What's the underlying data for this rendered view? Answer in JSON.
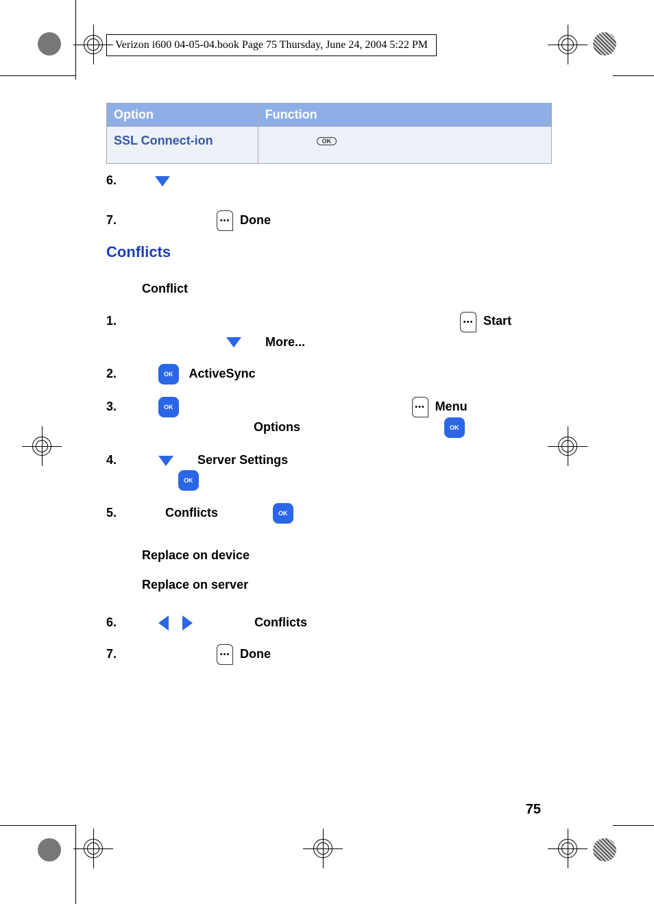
{
  "header_text": "Verizon i600 04-05-04.book  Page 75  Thursday, June 24, 2004  5:22 PM",
  "table": {
    "col1": "Option",
    "col2": "Function",
    "row1_col1": "SSL Connect-ion",
    "ok_outline": "OK"
  },
  "steps_a": {
    "s6_num": "6.",
    "s7_num": "7.",
    "s7_label": "Done"
  },
  "section_title": "Conflicts",
  "subheading": "Conflict",
  "steps_b": {
    "s1_num": "1.",
    "s1_start": "Start",
    "s1_more": "More...",
    "s2_num": "2.",
    "s2_label": "ActiveSync",
    "s3_num": "3.",
    "s3_menu": "Menu",
    "s3_options": "Options",
    "s4_num": "4.",
    "s4_label": "Server Settings",
    "s5_num": "5.",
    "s5_label": "Conflicts"
  },
  "ok_text": "OK",
  "replace_device": "Replace on device",
  "replace_server": "Replace on server",
  "steps_c": {
    "s6_num": "6.",
    "s6_label": "Conflicts",
    "s7_num": "7.",
    "s7_label": "Done"
  },
  "page_number": "75"
}
